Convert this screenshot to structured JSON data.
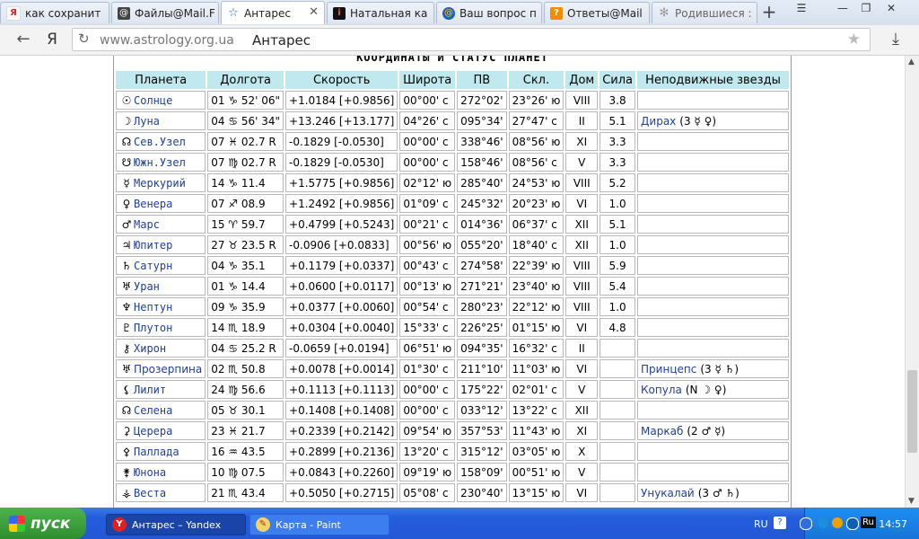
{
  "browser": {
    "tabs": [
      {
        "label": "как сохранит",
        "icon": "yandex-icon",
        "color": "#e02020"
      },
      {
        "label": "Файлы@Mail.F",
        "icon": "mail-icon",
        "color": "#1a5ec9"
      },
      {
        "label": "Антарес",
        "icon": "star-icon",
        "color": "#1a5ec9",
        "active": true
      },
      {
        "label": "Натальная ка",
        "icon": "info-icon",
        "color": "#c8141e"
      },
      {
        "label": "Ваш вопрос п",
        "icon": "mail-at-icon",
        "color": "#1a5ec9"
      },
      {
        "label": "Ответы@Mail",
        "icon": "question-icon",
        "color": "#f08c00"
      },
      {
        "label": "Родившиеся :",
        "icon": "gear-icon",
        "color": "#999999"
      }
    ],
    "close_glyph": "✕",
    "newtab_glyph": "+",
    "url_domain": "www.astrology.org.ua",
    "page_title": "Антарес",
    "back_glyph": "←",
    "yandex_glyph": "Я",
    "reload_glyph": "↻",
    "bookmark_glyph": "★",
    "download_glyph": "⤓",
    "window_min": "—",
    "window_max": "❐",
    "window_close": "✕",
    "window_menu": "☰"
  },
  "table": {
    "caption": "КООРДИНАТЫ И СТАТУС ПЛАНЕТ",
    "headers": [
      "Планета",
      "Долгота",
      "Скорость",
      "Широта",
      "ПВ",
      "Скл.",
      "Дом",
      "Сила",
      "Неподвижные звезды"
    ],
    "rows": [
      {
        "glyph": "☉",
        "planet": "Солнце",
        "lon": "01 ♑ 52' 06\"",
        "speed": "+1.0184  [+0.9856]",
        "lat": "00°00' с",
        "ra": "272°02'",
        "decl": "23°26' ю",
        "house": "VIII",
        "power": "3.8",
        "stars": ""
      },
      {
        "glyph": "☽",
        "planet": "Луна",
        "lon": "04 ♋ 56' 34\"",
        "speed": "+13.246  [+13.177]",
        "lat": "04°26' с",
        "ra": "095°34'",
        "decl": "27°47' с",
        "house": "II",
        "power": "5.1",
        "stars": "Дирах",
        "stars_extra": "(3 ☿ ♀)"
      },
      {
        "glyph": "☊",
        "planet": "Сев.Узел",
        "lon": "07 ♓ 02.7  R",
        "speed": "-0.1829  [-0.0530]",
        "lat": "00°00' с",
        "ra": "338°46'",
        "decl": "08°56' ю",
        "house": "XI",
        "power": "3.3",
        "stars": ""
      },
      {
        "glyph": "☋",
        "planet": "Южн.Узел",
        "lon": "07 ♍ 02.7  R",
        "speed": "-0.1829  [-0.0530]",
        "lat": "00°00' с",
        "ra": "158°46'",
        "decl": "08°56' с",
        "house": "V",
        "power": "3.3",
        "stars": ""
      },
      {
        "glyph": "☿",
        "planet": "Меркурий",
        "lon": "14 ♑ 11.4",
        "speed": "+1.5775  [+0.9856]",
        "lat": "02°12' ю",
        "ra": "285°40'",
        "decl": "24°53' ю",
        "house": "VIII",
        "power": "5.2",
        "stars": ""
      },
      {
        "glyph": "♀",
        "planet": "Венера",
        "lon": "07 ♐ 08.9",
        "speed": "+1.2492  [+0.9856]",
        "lat": "01°09' с",
        "ra": "245°32'",
        "decl": "20°23' ю",
        "house": "VI",
        "power": "1.0",
        "stars": ""
      },
      {
        "glyph": "♂",
        "planet": "Марс",
        "lon": "15 ♈ 59.7",
        "speed": "+0.4799  [+0.5243]",
        "lat": "00°21' с",
        "ra": "014°36'",
        "decl": "06°37' с",
        "house": "XII",
        "power": "5.1",
        "stars": ""
      },
      {
        "glyph": "♃",
        "planet": "Юпитер",
        "lon": "27 ♉ 23.5  R",
        "speed": "-0.0906  [+0.0833]",
        "lat": "00°56' ю",
        "ra": "055°20'",
        "decl": "18°40' с",
        "house": "XII",
        "power": "1.0",
        "stars": ""
      },
      {
        "glyph": "♄",
        "planet": "Сатурн",
        "lon": "04 ♑ 35.1",
        "speed": "+0.1179  [+0.0337]",
        "lat": "00°43' с",
        "ra": "274°58'",
        "decl": "22°39' ю",
        "house": "VIII",
        "power": "5.9",
        "stars": ""
      },
      {
        "glyph": "♅",
        "planet": "Уран",
        "lon": "01 ♑ 14.4",
        "speed": "+0.0600  [+0.0117]",
        "lat": "00°13' ю",
        "ra": "271°21'",
        "decl": "23°40' ю",
        "house": "VIII",
        "power": "5.4",
        "stars": ""
      },
      {
        "glyph": "♆",
        "planet": "Нептун",
        "lon": "09 ♑ 35.9",
        "speed": "+0.0377  [+0.0060]",
        "lat": "00°54' с",
        "ra": "280°23'",
        "decl": "22°12' ю",
        "house": "VIII",
        "power": "1.0",
        "stars": ""
      },
      {
        "glyph": "♇",
        "planet": "Плутон",
        "lon": "14 ♏ 18.9",
        "speed": "+0.0304  [+0.0040]",
        "lat": "15°33' с",
        "ra": "226°25'",
        "decl": "01°15' ю",
        "house": "VI",
        "power": "4.8",
        "stars": ""
      },
      {
        "glyph": "⚷",
        "planet": "Хирон",
        "lon": "04 ♋ 25.2  R",
        "speed": "-0.0659  [+0.0194]",
        "lat": "06°51' ю",
        "ra": "094°35'",
        "decl": "16°32' с",
        "house": "II",
        "power": "",
        "stars": ""
      },
      {
        "glyph": "♅",
        "planet": "Прозерпина",
        "reg": true,
        "lon": "02 ♏ 50.8",
        "speed": "+0.0078  [+0.0014]",
        "lat": "01°30' с",
        "ra": "211°10'",
        "decl": "11°03' ю",
        "house": "VI",
        "power": "",
        "stars": "Принцепс",
        "stars_extra": "(3 ☿ ♄)"
      },
      {
        "glyph": "⚸",
        "planet": "Лилит",
        "lon": "24 ♍ 56.6",
        "speed": "+0.1113  [+0.1113]",
        "lat": "00°00' с",
        "ra": "175°22'",
        "decl": "02°01' с",
        "house": "V",
        "power": "",
        "stars": "Копула",
        "stars_extra": "(N ☽ ♀)"
      },
      {
        "glyph": "☊",
        "planet": "Селена",
        "lon": "05 ♉ 30.1",
        "speed": "+0.1408  [+0.1408]",
        "lat": "00°00' с",
        "ra": "033°12'",
        "decl": "13°22' с",
        "house": "XII",
        "power": "",
        "stars": ""
      },
      {
        "glyph": "⚳",
        "planet": "Церера",
        "lon": "23 ♓ 21.7",
        "speed": "+0.2339  [+0.2142]",
        "lat": "09°54' ю",
        "ra": "357°53'",
        "decl": "11°43' ю",
        "house": "XI",
        "power": "",
        "stars": "Маркаб",
        "stars_extra": "(2 ♂ ☿)"
      },
      {
        "glyph": "⚴",
        "planet": "Паллада",
        "lon": "16 ♒ 43.5",
        "speed": "+0.2899  [+0.2136]",
        "lat": "13°20' с",
        "ra": "315°12'",
        "decl": "03°05' ю",
        "house": "X",
        "power": "",
        "stars": ""
      },
      {
        "glyph": "⚵",
        "planet": "Юнона",
        "lon": "10 ♍ 07.5",
        "speed": "+0.0843  [+0.2260]",
        "lat": "09°19' ю",
        "ra": "158°09'",
        "decl": "00°51' ю",
        "house": "V",
        "power": "",
        "stars": ""
      },
      {
        "glyph": "⚶",
        "planet": "Веста",
        "lon": "21 ♏ 43.4",
        "speed": "+0.5050  [+0.2715]",
        "lat": "05°08' с",
        "ra": "230°40'",
        "decl": "13°15' ю",
        "house": "VI",
        "power": "",
        "stars": "Унукалай",
        "stars_extra": "(3 ♂ ♄)"
      }
    ]
  },
  "taskbar": {
    "start_label": "пуск",
    "tasks": [
      {
        "label": "Антарес – Yandex",
        "icon": "yandex-icon",
        "active": true
      },
      {
        "label": "Карта - Paint",
        "icon": "paint-icon",
        "active": false
      }
    ],
    "lang": "RU",
    "help": "?",
    "tray_lang": "Ru",
    "clock": "14:57"
  }
}
